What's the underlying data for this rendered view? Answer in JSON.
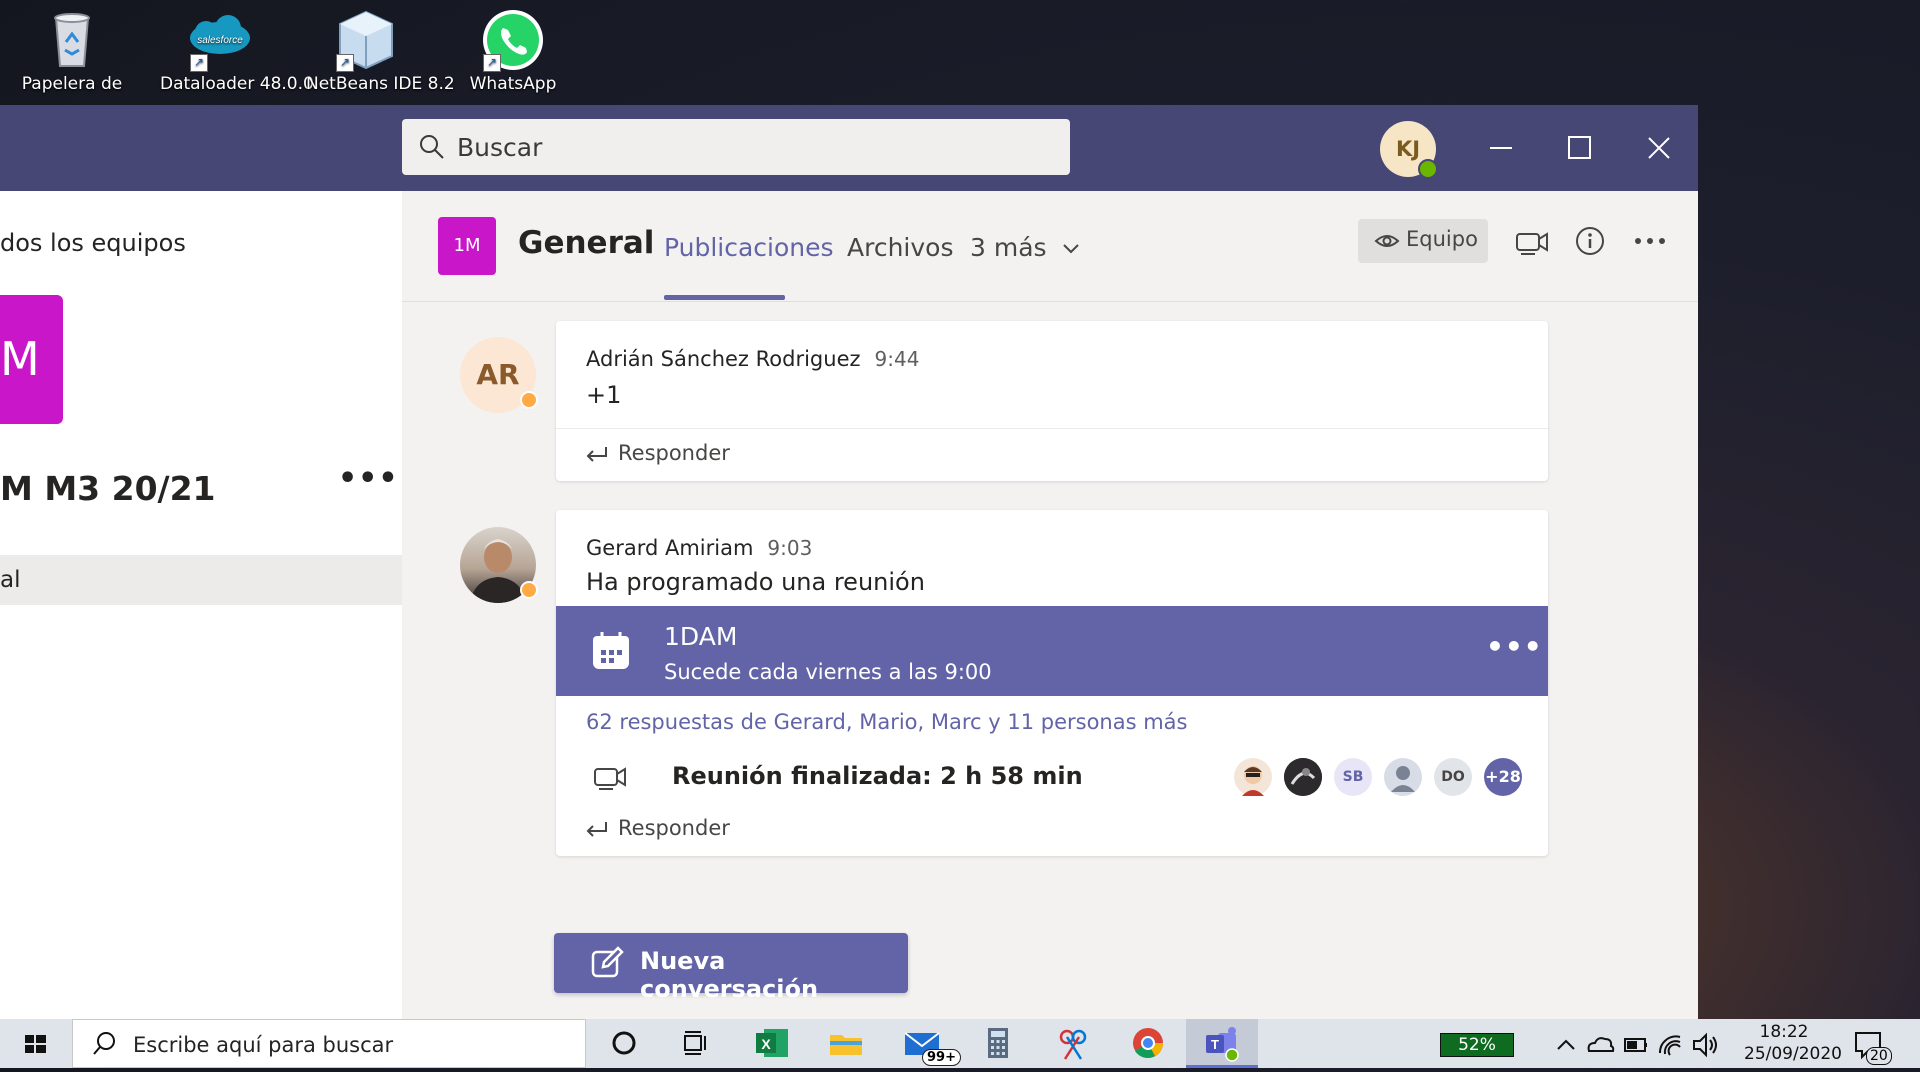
{
  "desktop": {
    "icons": [
      {
        "label": "Papelera de",
        "icon": "recycle-bin-icon"
      },
      {
        "label": "Dataloader 48.0.0",
        "icon": "salesforce-icon",
        "logo_text": "salesforce"
      },
      {
        "label": "NetBeans IDE 8.2",
        "icon": "netbeans-icon"
      },
      {
        "label": "WhatsApp",
        "icon": "whatsapp-icon"
      }
    ]
  },
  "titlebar": {
    "search_placeholder": "Buscar",
    "user_initials": "KJ"
  },
  "sidebar": {
    "all_teams": "dos los equipos",
    "team_tile": "M",
    "team_name": "M M3 20/21",
    "more": "•••",
    "channel": "al"
  },
  "channel": {
    "tile": "1M",
    "name": "General",
    "tabs": [
      "Publicaciones",
      "Archivos",
      "3 más"
    ],
    "team_button": "Equipo"
  },
  "messages": [
    {
      "initials": "AR",
      "author": "Adrián Sánchez Rodriguez",
      "time": "9:44",
      "text": "+1",
      "reply": "Responder"
    },
    {
      "author": "Gerard Amiriam",
      "time": "9:03",
      "text": "Ha programado una reunión",
      "meeting": {
        "title": "1DAM",
        "subtitle": "Sucede cada viernes a las 9:00",
        "more": "•••"
      },
      "replies_summary": "62 respuestas de Gerard, Mario, Marc y 11 personas más",
      "ended": "Reunión finalizada: 2 h 58 min",
      "participants": [
        "SB",
        "DO",
        "+28"
      ],
      "reply": "Responder"
    }
  ],
  "new_conversation": "Nueva conversación",
  "taskbar": {
    "search_placeholder": "Escribe aquí para buscar",
    "mail_badge": "99+",
    "battery": "52%",
    "time": "18:22",
    "date": "25/09/2020",
    "notifications": "20"
  },
  "colors": {
    "teams_purple": "#6264a7",
    "titlebar": "#464775",
    "team_magenta": "#c816c8"
  }
}
